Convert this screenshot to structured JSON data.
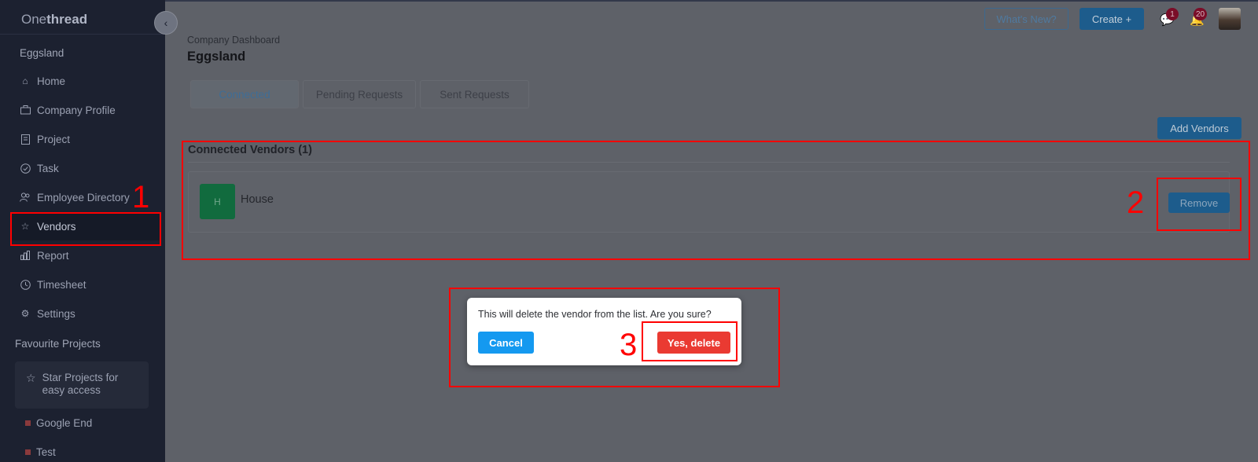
{
  "app": {
    "logo_light": "One",
    "logo_bold": "thread"
  },
  "sidebar": {
    "org_name": "Eggsland",
    "items": [
      {
        "label": "Home",
        "icon": "home-icon"
      },
      {
        "label": "Company Profile",
        "icon": "briefcase-icon"
      },
      {
        "label": "Project",
        "icon": "document-icon"
      },
      {
        "label": "Task",
        "icon": "check-circle-icon"
      },
      {
        "label": "Employee Directory",
        "icon": "users-icon"
      },
      {
        "label": "Vendors",
        "icon": "star-icon",
        "active": true
      },
      {
        "label": "Report",
        "icon": "bar-chart-icon"
      },
      {
        "label": "Timesheet",
        "icon": "clock-icon"
      },
      {
        "label": "Settings",
        "icon": "gear-icon"
      }
    ],
    "favourites_heading": "Favourite Projects",
    "star_prompt": "Star Projects for easy access",
    "favourite_projects": [
      "Google End",
      "Test"
    ]
  },
  "header": {
    "whats_new": "What's New?",
    "create": "Create +",
    "chat_badge": "1",
    "notification_badge": "20"
  },
  "page": {
    "breadcrumb": "Company Dashboard",
    "title": "Eggsland",
    "tabs": [
      {
        "label": "Connected",
        "active": true
      },
      {
        "label": "Pending Requests"
      },
      {
        "label": "Sent Requests"
      }
    ],
    "add_vendors": "Add Vendors",
    "connected_title": "Connected Vendors (1)",
    "vendors": [
      {
        "initial": "H",
        "name": "House",
        "action": "Remove"
      }
    ]
  },
  "dialog": {
    "message": "This will delete the vendor from the list. Are you sure?",
    "cancel": "Cancel",
    "confirm": "Yes, delete"
  },
  "annotations": [
    "1",
    "2",
    "3"
  ],
  "colors": {
    "sidebar_bg": "#1c2130",
    "primary_button": "#1499f0",
    "danger_button": "#ea3a32",
    "annotation": "#ff0000",
    "vendor_avatar": "#116b3e"
  }
}
